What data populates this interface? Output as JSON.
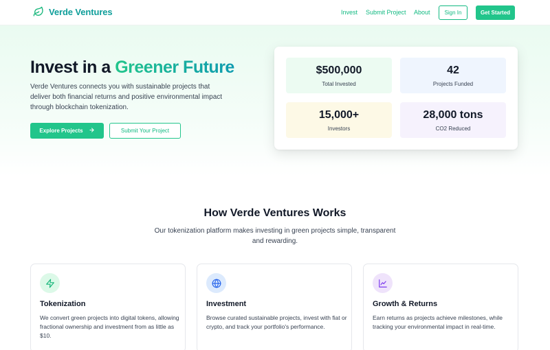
{
  "header": {
    "brand": "Verde Ventures",
    "nav": [
      "Invest",
      "Submit Project",
      "About"
    ],
    "sign_in": "Sign In",
    "get_started": "Get Started"
  },
  "hero": {
    "title_prefix": "Invest in a ",
    "title_accent": "Greener Future",
    "description": "Verde Ventures connects you with sustainable projects that deliver both financial returns and positive environmental impact through blockchain tokenization.",
    "primary_cta": "Explore Projects",
    "secondary_cta": "Submit Your Project"
  },
  "stats": [
    {
      "value": "$500,000",
      "label": "Total Invested",
      "color": "#ecfbf2"
    },
    {
      "value": "42",
      "label": "Projects Funded",
      "color": "#eff5fe"
    },
    {
      "value": "15,000+",
      "label": "Investors",
      "color": "#fdf9e6"
    },
    {
      "value": "28,000 tons",
      "label": "CO2 Reduced",
      "color": "#f6f2fd"
    }
  ],
  "how_it_works": {
    "title": "How Verde Ventures Works",
    "description": "Our tokenization platform makes investing in green projects simple, transparent and rewarding.",
    "features": [
      {
        "icon": "lightning-icon",
        "title": "Tokenization",
        "description": "We convert green projects into digital tokens, allowing fractional ownership and investment from as little as $10.",
        "icon_bg": "#dcf9e8",
        "icon_color": "#16b67a"
      },
      {
        "icon": "globe-icon",
        "title": "Investment",
        "description": "Browse curated sustainable projects, invest with fiat or crypto, and track your portfolio's performance.",
        "icon_bg": "#dceafd",
        "icon_color": "#2563eb"
      },
      {
        "icon": "chart-icon",
        "title": "Growth & Returns",
        "description": "Earn returns as projects achieve milestones, while tracking your environmental impact in real-time.",
        "icon_bg": "#efe3fb",
        "icon_color": "#7c3aed"
      }
    ]
  },
  "colors": {
    "accent": "#22c58b",
    "brand": "#0f9e9a"
  }
}
